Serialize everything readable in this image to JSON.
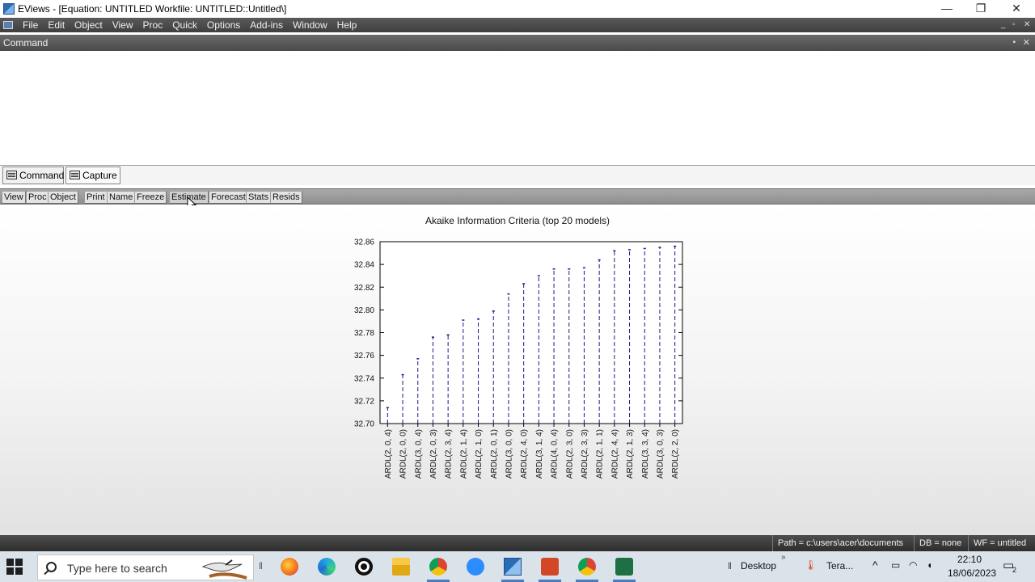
{
  "window": {
    "title": "EViews - [Equation: UNTITLED   Workfile: UNTITLED::Untitled\\]",
    "controls": {
      "minimize": "—",
      "restore": "❐",
      "close": "✕"
    }
  },
  "menu": {
    "items": [
      "File",
      "Edit",
      "Object",
      "View",
      "Proc",
      "Quick",
      "Options",
      "Add-ins",
      "Window",
      "Help"
    ],
    "mdi_controls": {
      "minimize": "_",
      "restore": "▫",
      "close": "✕"
    }
  },
  "command_panel": {
    "header": "Command",
    "pin_glyph": "▪",
    "close_glyph": "✕"
  },
  "tabs": {
    "command": "Command",
    "capture": "Capture"
  },
  "equation_toolbar": {
    "buttons": [
      "View",
      "Proc",
      "Object",
      "Print",
      "Name",
      "Freeze",
      "Estimate",
      "Forecast",
      "Stats",
      "Resids"
    ]
  },
  "chart_data": {
    "type": "bar",
    "title": "Akaike Information Criteria (top 20 models)",
    "xlabel": "",
    "ylabel": "",
    "ylim": [
      32.7,
      32.86
    ],
    "yticks": [
      "32.86",
      "32.84",
      "32.82",
      "32.80",
      "32.78",
      "32.76",
      "32.74",
      "32.72",
      "32.70"
    ],
    "categories": [
      "ARDL(2, 0, 4)",
      "ARDL(2, 0, 0)",
      "ARDL(3, 0, 4)",
      "ARDL(2, 0, 3)",
      "ARDL(2, 3, 4)",
      "ARDL(2, 1, 4)",
      "ARDL(2, 1, 0)",
      "ARDL(2, 0, 1)",
      "ARDL(3, 0, 0)",
      "ARDL(2, 4, 0)",
      "ARDL(3, 1, 4)",
      "ARDL(4, 0, 4)",
      "ARDL(2, 3, 0)",
      "ARDL(2, 3, 3)",
      "ARDL(2, 1, 1)",
      "ARDL(2, 4, 4)",
      "ARDL(2, 1, 3)",
      "ARDL(3, 3, 4)",
      "ARDL(3, 0, 3)",
      "ARDL(2, 2, 0)"
    ],
    "values": [
      32.714,
      32.743,
      32.757,
      32.776,
      32.778,
      32.791,
      32.792,
      32.799,
      32.814,
      32.823,
      32.83,
      32.836,
      32.836,
      32.837,
      32.844,
      32.852,
      32.853,
      32.854,
      32.855,
      32.856
    ],
    "grid": false,
    "legend": "none",
    "marker_color": "#1a1a8c"
  },
  "statusbar": {
    "path": "Path = c:\\users\\acer\\documents",
    "db": "DB = none",
    "wf": "WF = untitled"
  },
  "taskbar": {
    "search_placeholder": "Type here to search",
    "desktop_label": "Desktop",
    "weather_label": "Tera...",
    "time": "22:10",
    "date": "18/06/2023",
    "notification_count": "2",
    "apps": [
      "firefox-icon",
      "edge-icon",
      "media-icon",
      "file-explorer-icon",
      "chrome-icon",
      "zoom-icon",
      "eviews-icon",
      "powerpoint-icon",
      "chrome-profile-icon",
      "excel-icon"
    ]
  }
}
